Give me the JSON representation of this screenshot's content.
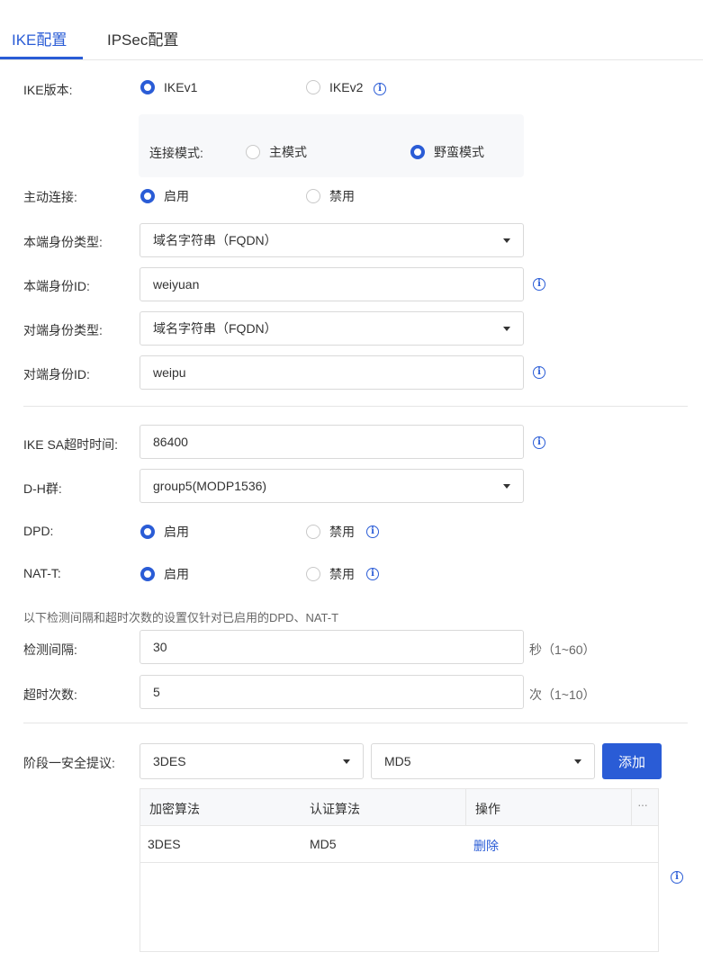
{
  "tabs": [
    {
      "label": "IKE配置",
      "active": true
    },
    {
      "label": "IPSec配置",
      "active": false
    }
  ],
  "ike_version": {
    "label": "IKE版本:",
    "options": [
      "IKEv1",
      "IKEv2"
    ],
    "selected": "IKEv1"
  },
  "connect_mode": {
    "label": "连接模式:",
    "options": [
      "主模式",
      "野蛮模式"
    ],
    "selected": "野蛮模式"
  },
  "active_connect": {
    "label": "主动连接:",
    "options": [
      "启用",
      "禁用"
    ],
    "selected": "启用"
  },
  "local_id_type": {
    "label": "本端身份类型:",
    "value": "域名字符串（FQDN）"
  },
  "local_id": {
    "label": "本端身份ID:",
    "value": "weiyuan"
  },
  "peer_id_type": {
    "label": "对端身份类型:",
    "value": "域名字符串（FQDN）"
  },
  "peer_id": {
    "label": "对端身份ID:",
    "value": "weipu"
  },
  "ike_sa_timeout": {
    "label": "IKE SA超时时间:",
    "value": "86400"
  },
  "dh_group": {
    "label": "D-H群:",
    "value": "group5(MODP1536)"
  },
  "dpd": {
    "label": "DPD:",
    "options": [
      "启用",
      "禁用"
    ],
    "selected": "启用"
  },
  "nat_t": {
    "label": "NAT-T:",
    "options": [
      "启用",
      "禁用"
    ],
    "selected": "启用"
  },
  "hint": "以下检测间隔和超时次数的设置仅针对已启用的DPD、NAT-T",
  "detect_interval": {
    "label": "检测间隔:",
    "value": "30",
    "unit": "秒（1~60）"
  },
  "timeout_count": {
    "label": "超时次数:",
    "value": "5",
    "unit": "次（1~10）"
  },
  "phase1": {
    "label": "阶段一安全提议:",
    "encryption": "3DES",
    "auth": "MD5",
    "add_label": "添加",
    "columns": [
      "加密算法",
      "认证算法",
      "操作"
    ],
    "more_icon": "···",
    "rows": [
      {
        "encryption": "3DES",
        "auth": "MD5",
        "action": "删除"
      }
    ]
  },
  "colors": {
    "accent": "#2a5cd6",
    "border": "#d9d9d9",
    "table_header": "#f7f8fa"
  }
}
